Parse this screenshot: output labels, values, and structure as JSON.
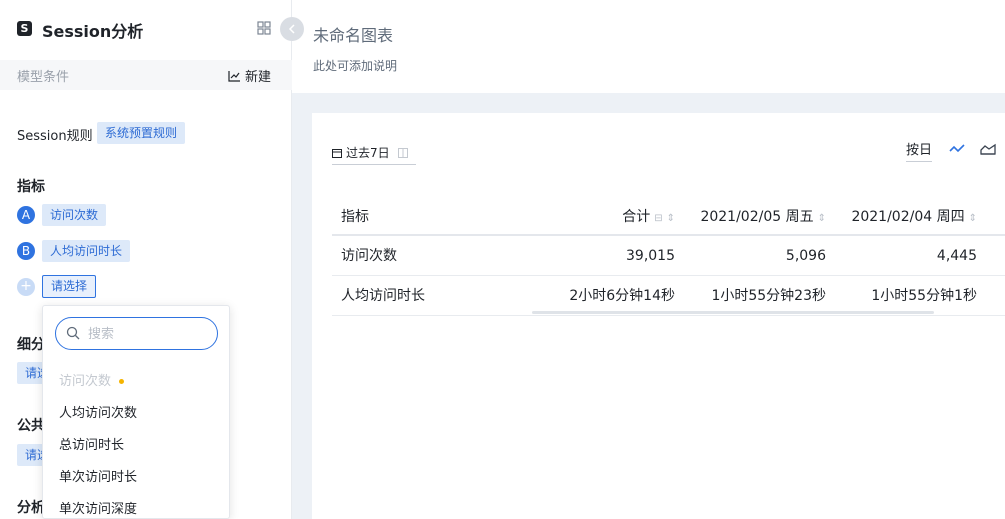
{
  "sidebar": {
    "logo_glyph": "S",
    "title": "Session分析",
    "model_conditions": "模型条件",
    "new_label": "新建",
    "session_rule_label": "Session规则",
    "session_rule_tag": "系统预置规则",
    "metrics_title": "指标",
    "metrics": [
      {
        "letter": "A",
        "label": "访问次数"
      },
      {
        "letter": "B",
        "label": "人均访问时长"
      }
    ],
    "add_glyph": "+",
    "select_placeholder": "请选择",
    "breakdown_title": "细分",
    "breakdown_tag": "请选",
    "common_title": "公共",
    "common_tag": "请选",
    "analysis_title": "分析"
  },
  "dropdown": {
    "search_placeholder": "搜索",
    "items": [
      {
        "label": "访问次数",
        "disabled": true
      },
      {
        "label": "人均访问次数",
        "disabled": false
      },
      {
        "label": "总访问时长",
        "disabled": false
      },
      {
        "label": "单次访问时长",
        "disabled": false
      },
      {
        "label": "单次访问深度",
        "disabled": false
      }
    ]
  },
  "main": {
    "chart_title": "未命名图表",
    "chart_desc": "此处可添加说明",
    "date_range": "过去7日",
    "granularity": "按日",
    "table": {
      "headers": [
        "指标",
        "合计",
        "2021/02/05 周五",
        "2021/02/04 周四"
      ],
      "rows": [
        [
          "访问次数",
          "39,015",
          "5,096",
          "4,445"
        ],
        [
          "人均访问时长",
          "2小时6分钟14秒",
          "1小时55分钟23秒",
          "1小时55分钟1秒"
        ]
      ]
    }
  },
  "colors": {
    "accent": "#2f73e0",
    "tag_bg": "#dde9f9",
    "page_bg": "#edf1f6"
  }
}
